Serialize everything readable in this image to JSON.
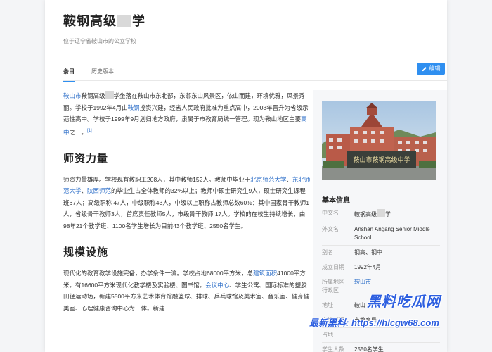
{
  "header": {
    "title_before": "鞍钢高级",
    "title_after": "学",
    "subtitle": "位于辽宁省鞍山市的公立学校"
  },
  "tabs": [
    {
      "label": "条目"
    },
    {
      "label": "历史版本"
    }
  ],
  "toolbar": {
    "edit_label": "编辑"
  },
  "intro": {
    "link_city": "鞍山市",
    "text_1": "鞍钢高级",
    "text_2": "学坐落在鞍山市东北部，东邻东山风景区，依山而建，环境优雅，风景秀丽。学校于1992年4月由",
    "link_angang": "鞍钢",
    "text_3": "投资兴建，经省人民政府批准为重点高中，2003年晋升为省级示范性高中。学校于1999年9月划归地方政府，隶属于市教育局统一管理。现为鞍山地区主要",
    "link_highschool": "高中",
    "text_4": "之一。",
    "ref": "[1]"
  },
  "section_teachers": {
    "heading": "师资力量",
    "text_1": "师资力量雄厚。学校现有教职工208人，其中教师152人。教师中毕业于",
    "link_bnu": "北京师范大学",
    "sep_1": "、",
    "link_ecnu": "东北师范大学",
    "sep_2": "、",
    "link_snnu": "陕西师范",
    "text_2": "的毕业生占全体教师的32%以上；教师中硕士研究生9人，硕士研究生课程班67人；高级职称 47人，中级职称43人，中级以上职称占教师总数60%：其中国家骨干教师1人，省级骨干教师3人，首席责任教师5人，市级骨干教师 17人。学校的在校生持续增长，由98年21个教学班、1100名学生增长为目前43个教学班、2550名学生。"
  },
  "section_facilities": {
    "heading": "规模设施",
    "text_1": "现代化的教育教学设施完备，办学条件一流。学校占地68000平方米，总",
    "link_area": "建筑面积",
    "text_2": "41000平方米。有16600平方米现代化教学楼及实验楼、图书馆。",
    "link_conf": "会议中心",
    "text_3": "、学生公寓、国际标准的塑胶田径运动场，新建5500平方米艺术体育馆融篮球、排球、乒乓球馆及美术室、音乐室、健身健美室、心理健康咨询中心为一体。新建"
  },
  "infobox": {
    "title": "基本信息",
    "rows": [
      {
        "k": "中文名",
        "v_before": "鞍钢高级",
        "v_after": "学"
      },
      {
        "k": "外文名",
        "v": "Anshan Angang Senior Middle School"
      },
      {
        "k": "别名",
        "v": "钢高、钢中"
      },
      {
        "k": "成立日期",
        "v": "1992年4月"
      },
      {
        "k": "所属地区",
        "k2": "行政区",
        "v": "鞍山市"
      },
      {
        "k": "地址",
        "v": "鞍山"
      },
      {
        "k": "主管部门",
        "v": "市教育局"
      },
      {
        "k": "占地",
        "v": ""
      },
      {
        "k": "学生人数",
        "v": "2550名学生"
      }
    ]
  },
  "photo": {
    "sign_text": "鞍山市鞍钢高级中学"
  },
  "watermark": {
    "line1": "黑料吃瓜网",
    "line2": "最新黑料: https://hlcgw68.com"
  },
  "colors": {
    "accent": "#2f8ff0",
    "link": "#2f70c9",
    "watermark": "#2d5fe0"
  }
}
